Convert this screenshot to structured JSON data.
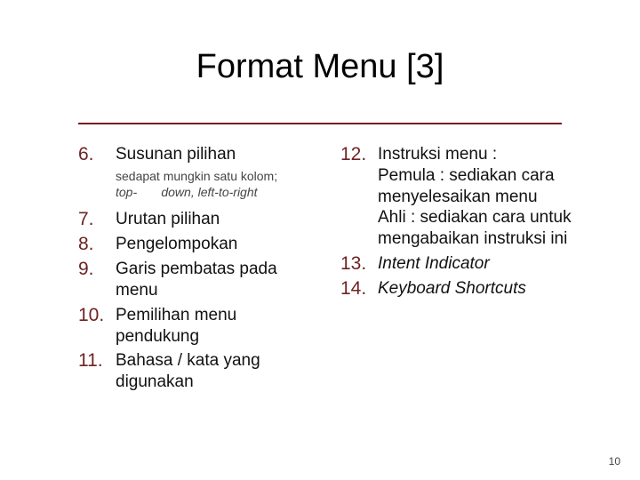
{
  "title": "Format Menu [3]",
  "left": {
    "items": [
      {
        "n": "6.",
        "t": "Susunan pilihan"
      },
      {
        "n": "7.",
        "t": "Urutan pilihan"
      },
      {
        "n": "8.",
        "t": "Pengelompokan"
      },
      {
        "n": "9.",
        "t": "Garis pembatas pada menu"
      },
      {
        "n": "10.",
        "t": "Pemilihan menu pendukung"
      },
      {
        "n": "11.",
        "t": "Bahasa / kata yang digunakan"
      }
    ],
    "sub_a": "sedapat mungkin satu kolom; ",
    "sub_b": "top-       down, left-to-right"
  },
  "right": {
    "item12_n": "12.",
    "item12_lines": [
      "Instruksi menu :",
      "Pemula : sediakan cara menyelesaikan menu",
      "Ahli : sediakan cara untuk mengabaikan instruksi ini"
    ],
    "item13": {
      "n": "13.",
      "t": "Intent Indicator"
    },
    "item14": {
      "n": "14.",
      "t": "Keyboard Shortcuts"
    }
  },
  "page": "10"
}
